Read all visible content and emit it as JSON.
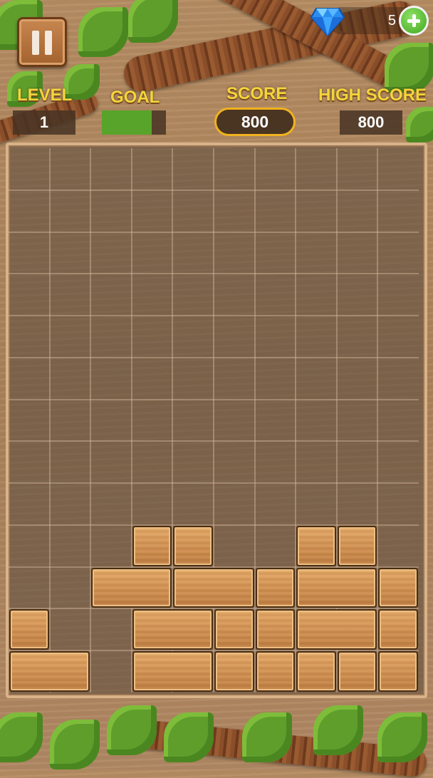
{
  "hud": {
    "level_label": "LEVEL",
    "level_value": "1",
    "goal_label": "GOAL",
    "goal_progress": 0.78,
    "score_label": "SCORE",
    "score_value": "800",
    "high_score_label": "HIGH SCORE",
    "high_score_value": "800"
  },
  "gems": {
    "count": "5",
    "icon": "diamond-icon"
  },
  "buttons": {
    "pause": "pause-icon",
    "add_gems": "plus-icon"
  },
  "colors": {
    "label": "#f4d43b",
    "goal_fill": "#58a42a",
    "score_border": "#f0b21f",
    "block": "#d08f4f"
  },
  "board": {
    "columns": 10,
    "rows": 13,
    "blocks": [
      {
        "row": 9,
        "col": 3,
        "w": 1,
        "h": 1
      },
      {
        "row": 9,
        "col": 4,
        "w": 1,
        "h": 1
      },
      {
        "row": 9,
        "col": 7,
        "w": 1,
        "h": 1
      },
      {
        "row": 9,
        "col": 8,
        "w": 1,
        "h": 1
      },
      {
        "row": 10,
        "col": 2,
        "w": 2,
        "h": 1
      },
      {
        "row": 10,
        "col": 4,
        "w": 2,
        "h": 1
      },
      {
        "row": 10,
        "col": 6,
        "w": 1,
        "h": 1
      },
      {
        "row": 10,
        "col": 7,
        "w": 2,
        "h": 1
      },
      {
        "row": 10,
        "col": 9,
        "w": 1,
        "h": 1
      },
      {
        "row": 11,
        "col": 0,
        "w": 1,
        "h": 1
      },
      {
        "row": 11,
        "col": 3,
        "w": 2,
        "h": 1
      },
      {
        "row": 11,
        "col": 5,
        "w": 1,
        "h": 1
      },
      {
        "row": 11,
        "col": 6,
        "w": 1,
        "h": 1
      },
      {
        "row": 11,
        "col": 7,
        "w": 2,
        "h": 1
      },
      {
        "row": 11,
        "col": 9,
        "w": 1,
        "h": 1
      },
      {
        "row": 12,
        "col": 0,
        "w": 2,
        "h": 1
      },
      {
        "row": 12,
        "col": 3,
        "w": 2,
        "h": 1
      },
      {
        "row": 12,
        "col": 5,
        "w": 1,
        "h": 1
      },
      {
        "row": 12,
        "col": 6,
        "w": 1,
        "h": 1
      },
      {
        "row": 12,
        "col": 7,
        "w": 1,
        "h": 1
      },
      {
        "row": 12,
        "col": 8,
        "w": 1,
        "h": 1
      },
      {
        "row": 12,
        "col": 9,
        "w": 1,
        "h": 1
      }
    ]
  }
}
